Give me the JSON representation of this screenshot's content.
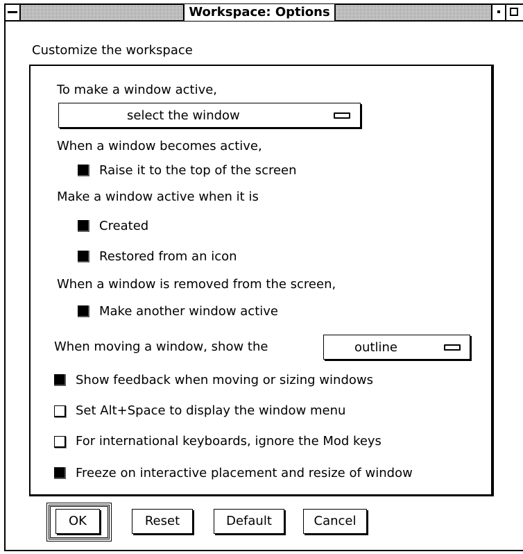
{
  "window": {
    "title": "Workspace: Options",
    "heading": "Customize the workspace"
  },
  "options": {
    "activate_label": "To make a window active,",
    "activate_select": "select the window",
    "becomes_active_label": "When a window becomes active,",
    "raise_label": "Raise it to the top of the screen",
    "raise_checked": true,
    "make_active_when_label": "Make a window active when it is",
    "created_label": "Created",
    "created_checked": true,
    "restored_label": "Restored from an icon",
    "restored_checked": true,
    "removed_label": "When a window is removed from the screen,",
    "another_active_label": "Make another window active",
    "another_active_checked": true,
    "moving_label": "When moving a window, show the",
    "moving_select": "outline",
    "feedback_label": "Show feedback when moving or sizing windows",
    "feedback_checked": true,
    "altspace_label": "Set Alt+Space to display the window menu",
    "altspace_checked": false,
    "intl_label": "For international keyboards, ignore the Mod keys",
    "intl_checked": false,
    "freeze_label": "Freeze on interactive placement and resize of window",
    "freeze_checked": true
  },
  "buttons": {
    "ok": "OK",
    "reset": "Reset",
    "default": "Default",
    "cancel": "Cancel"
  }
}
